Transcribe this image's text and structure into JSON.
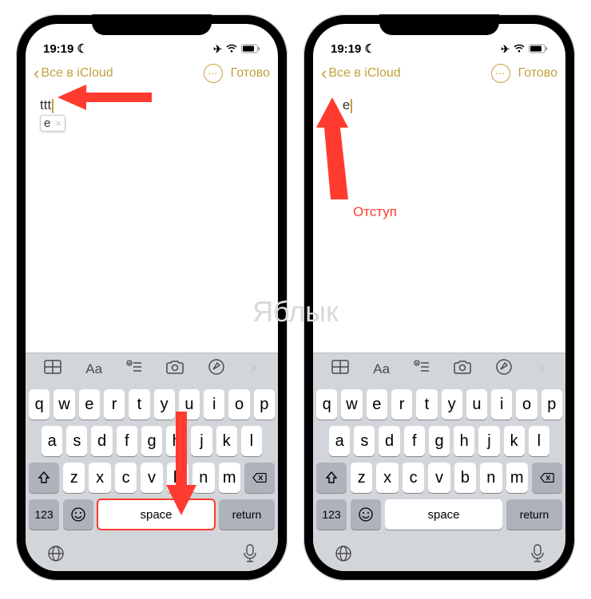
{
  "watermark": "Яблык",
  "status": {
    "time": "19:19",
    "moon": "☾",
    "airplane": "✈",
    "wifi": "􀙇",
    "battery": "􀛨"
  },
  "nav": {
    "back": "Все в iCloud",
    "done": "Готово",
    "more": "⋯"
  },
  "left": {
    "typed": "ttt",
    "suggestion": "e",
    "suggestion_close": "×"
  },
  "right": {
    "typed": "e",
    "indent_prefix": "    ",
    "label": "Отступ"
  },
  "toolbar": {
    "table": "⊞",
    "aa": "Aa",
    "list": "☑",
    "camera": "◉",
    "pen": "Ⓐ",
    "close": "✕"
  },
  "keys": {
    "r1": [
      "q",
      "w",
      "e",
      "r",
      "t",
      "y",
      "u",
      "i",
      "o",
      "p"
    ],
    "r2": [
      "a",
      "s",
      "d",
      "f",
      "g",
      "h",
      "j",
      "k",
      "l"
    ],
    "r3": [
      "z",
      "x",
      "c",
      "v",
      "b",
      "n",
      "m"
    ],
    "num": "123",
    "space": "space",
    "return": "return"
  }
}
